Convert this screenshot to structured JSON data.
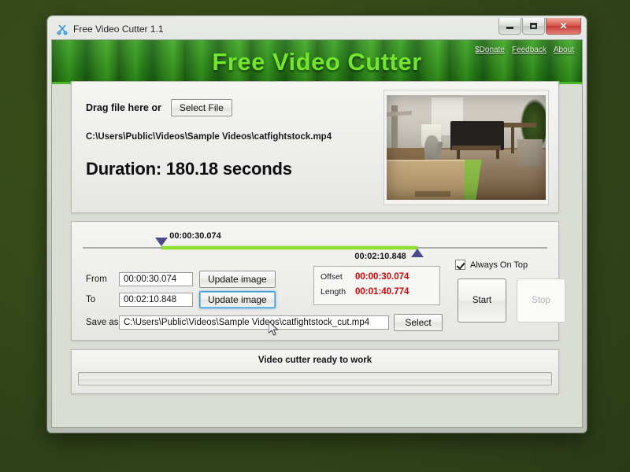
{
  "window": {
    "title": "Free Video Cutter 1.1",
    "icon": "scissors-icon",
    "minimize_label": "Minimize",
    "maximize_label": "Maximize",
    "close_label": "✕"
  },
  "banner": {
    "title": "Free Video Cutter",
    "title_color": "#73e62b",
    "links": [
      {
        "label": "$Donate"
      },
      {
        "label": "Feedback"
      },
      {
        "label": "About"
      }
    ]
  },
  "file_panel": {
    "drag_label": "Drag file here or",
    "select_file_label": "Select File",
    "file_path": "C:\\Users\\Public\\Videos\\Sample Videos\\catfightstock.mp4",
    "duration_label": "Duration: 180.18 seconds"
  },
  "timeline": {
    "from_label": "00:00:30.074",
    "to_label": "00:02:10.848",
    "from_percent": 17,
    "to_percent": 72,
    "range_color": "#8ce02a",
    "marker_color": "#4a4a8c"
  },
  "cut_panel": {
    "from_field_label": "From",
    "from_value": "00:00:30.074",
    "to_field_label": "To",
    "to_value": "00:02:10.848",
    "update_image_label": "Update image",
    "update_image_label_2": "Update image",
    "offset_key": "Offset",
    "offset_value": "00:00:30.074",
    "length_key": "Length",
    "length_value": "00:01:40.774",
    "value_color": "#d40000",
    "always_on_top_label": "Always On Top",
    "always_on_top_checked": true,
    "start_label": "Start",
    "stop_label": "Stop",
    "stop_disabled": true,
    "save_as_label": "Save as",
    "save_as_value": "C:\\Users\\Public\\Videos\\Sample Videos\\catfightstock_cut.mp4",
    "select_label": "Select"
  },
  "status_panel": {
    "status_text": "Video cutter ready to work",
    "progress_percent": 0
  }
}
